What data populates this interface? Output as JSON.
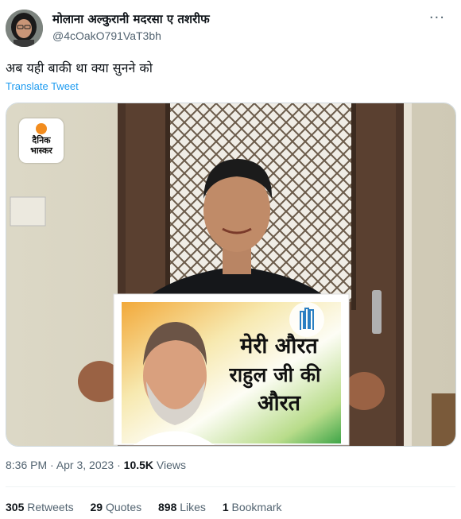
{
  "tweet": {
    "display_name": "मोलाना अल्कुरानी मदरसा ए तशरीफ",
    "handle": "@4cOakO791VaT3bh",
    "text": "अब यही बाकी था क्या सुनने को",
    "translate_label": "Translate Tweet",
    "time": "8:36 PM",
    "date": "Apr 3, 2023",
    "views_count": "10.5K",
    "views_label": "Views"
  },
  "media": {
    "logo_text_line1": "दैनिक",
    "logo_text_line2": "भास्कर",
    "placard_line1": "मेरी औरत",
    "placard_line2": "राहुल जी की",
    "placard_line3": "औरत"
  },
  "stats": {
    "retweets_count": "305",
    "retweets_label": "Retweets",
    "quotes_count": "29",
    "quotes_label": "Quotes",
    "likes_count": "898",
    "likes_label": "Likes",
    "bookmarks_count": "1",
    "bookmarks_label": "Bookmark"
  },
  "icons": {
    "more": "more-icon"
  }
}
